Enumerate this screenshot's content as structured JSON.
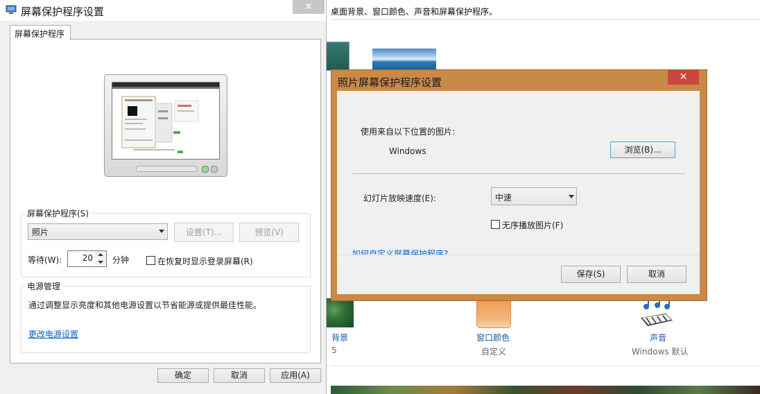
{
  "background_window": {
    "description": "桌面背景、窗口颜色、声音和屏幕保护程序。",
    "desktop_background_label": "背景",
    "desktop_background_sub": "5",
    "window_color_label": "窗口颜色",
    "window_color_sub": "自定义",
    "sound_label": "声音",
    "sound_sub": "Windows 默认"
  },
  "screensaver_dialog": {
    "title": "屏幕保护程序设置",
    "close_symbol": "✕",
    "tab_label": "屏幕保护程序",
    "saver_group_label": "屏幕保护程序(S)",
    "saver_selected": "照片",
    "settings_button": "设置(T)...",
    "preview_button": "预览(V)",
    "wait_label": "等待(W):",
    "wait_value": "20",
    "wait_unit": "分钟",
    "logon_label": "在恢复时显示登录屏幕(R)",
    "logon_checked": false,
    "power_group_label": "电源管理",
    "power_description": "通过调整显示亮度和其他电源设置以节省能源或提供最佳性能。",
    "power_link": "更改电源设置",
    "ok_button": "确定",
    "cancel_button": "取消",
    "apply_button": "应用(A)"
  },
  "photo_dialog": {
    "title": "照片屏幕保护程序设置",
    "close_symbol": "✕",
    "source_label": "使用来自以下位置的图片:",
    "source_value": "Windows",
    "browse_button": "浏览(B)...",
    "speed_label": "幻灯片放映速度(E):",
    "speed_selected": "中速",
    "shuffle_label": "无序播放图片(F)",
    "shuffle_checked": false,
    "help_link": "如何自定义屏幕保护程序?",
    "save_button": "保存(S)",
    "cancel_button": "取消"
  },
  "colors": {
    "photo_dialog_frame": "#c98a47",
    "close_button_active": "#c9473f",
    "link": "#0066cc"
  }
}
